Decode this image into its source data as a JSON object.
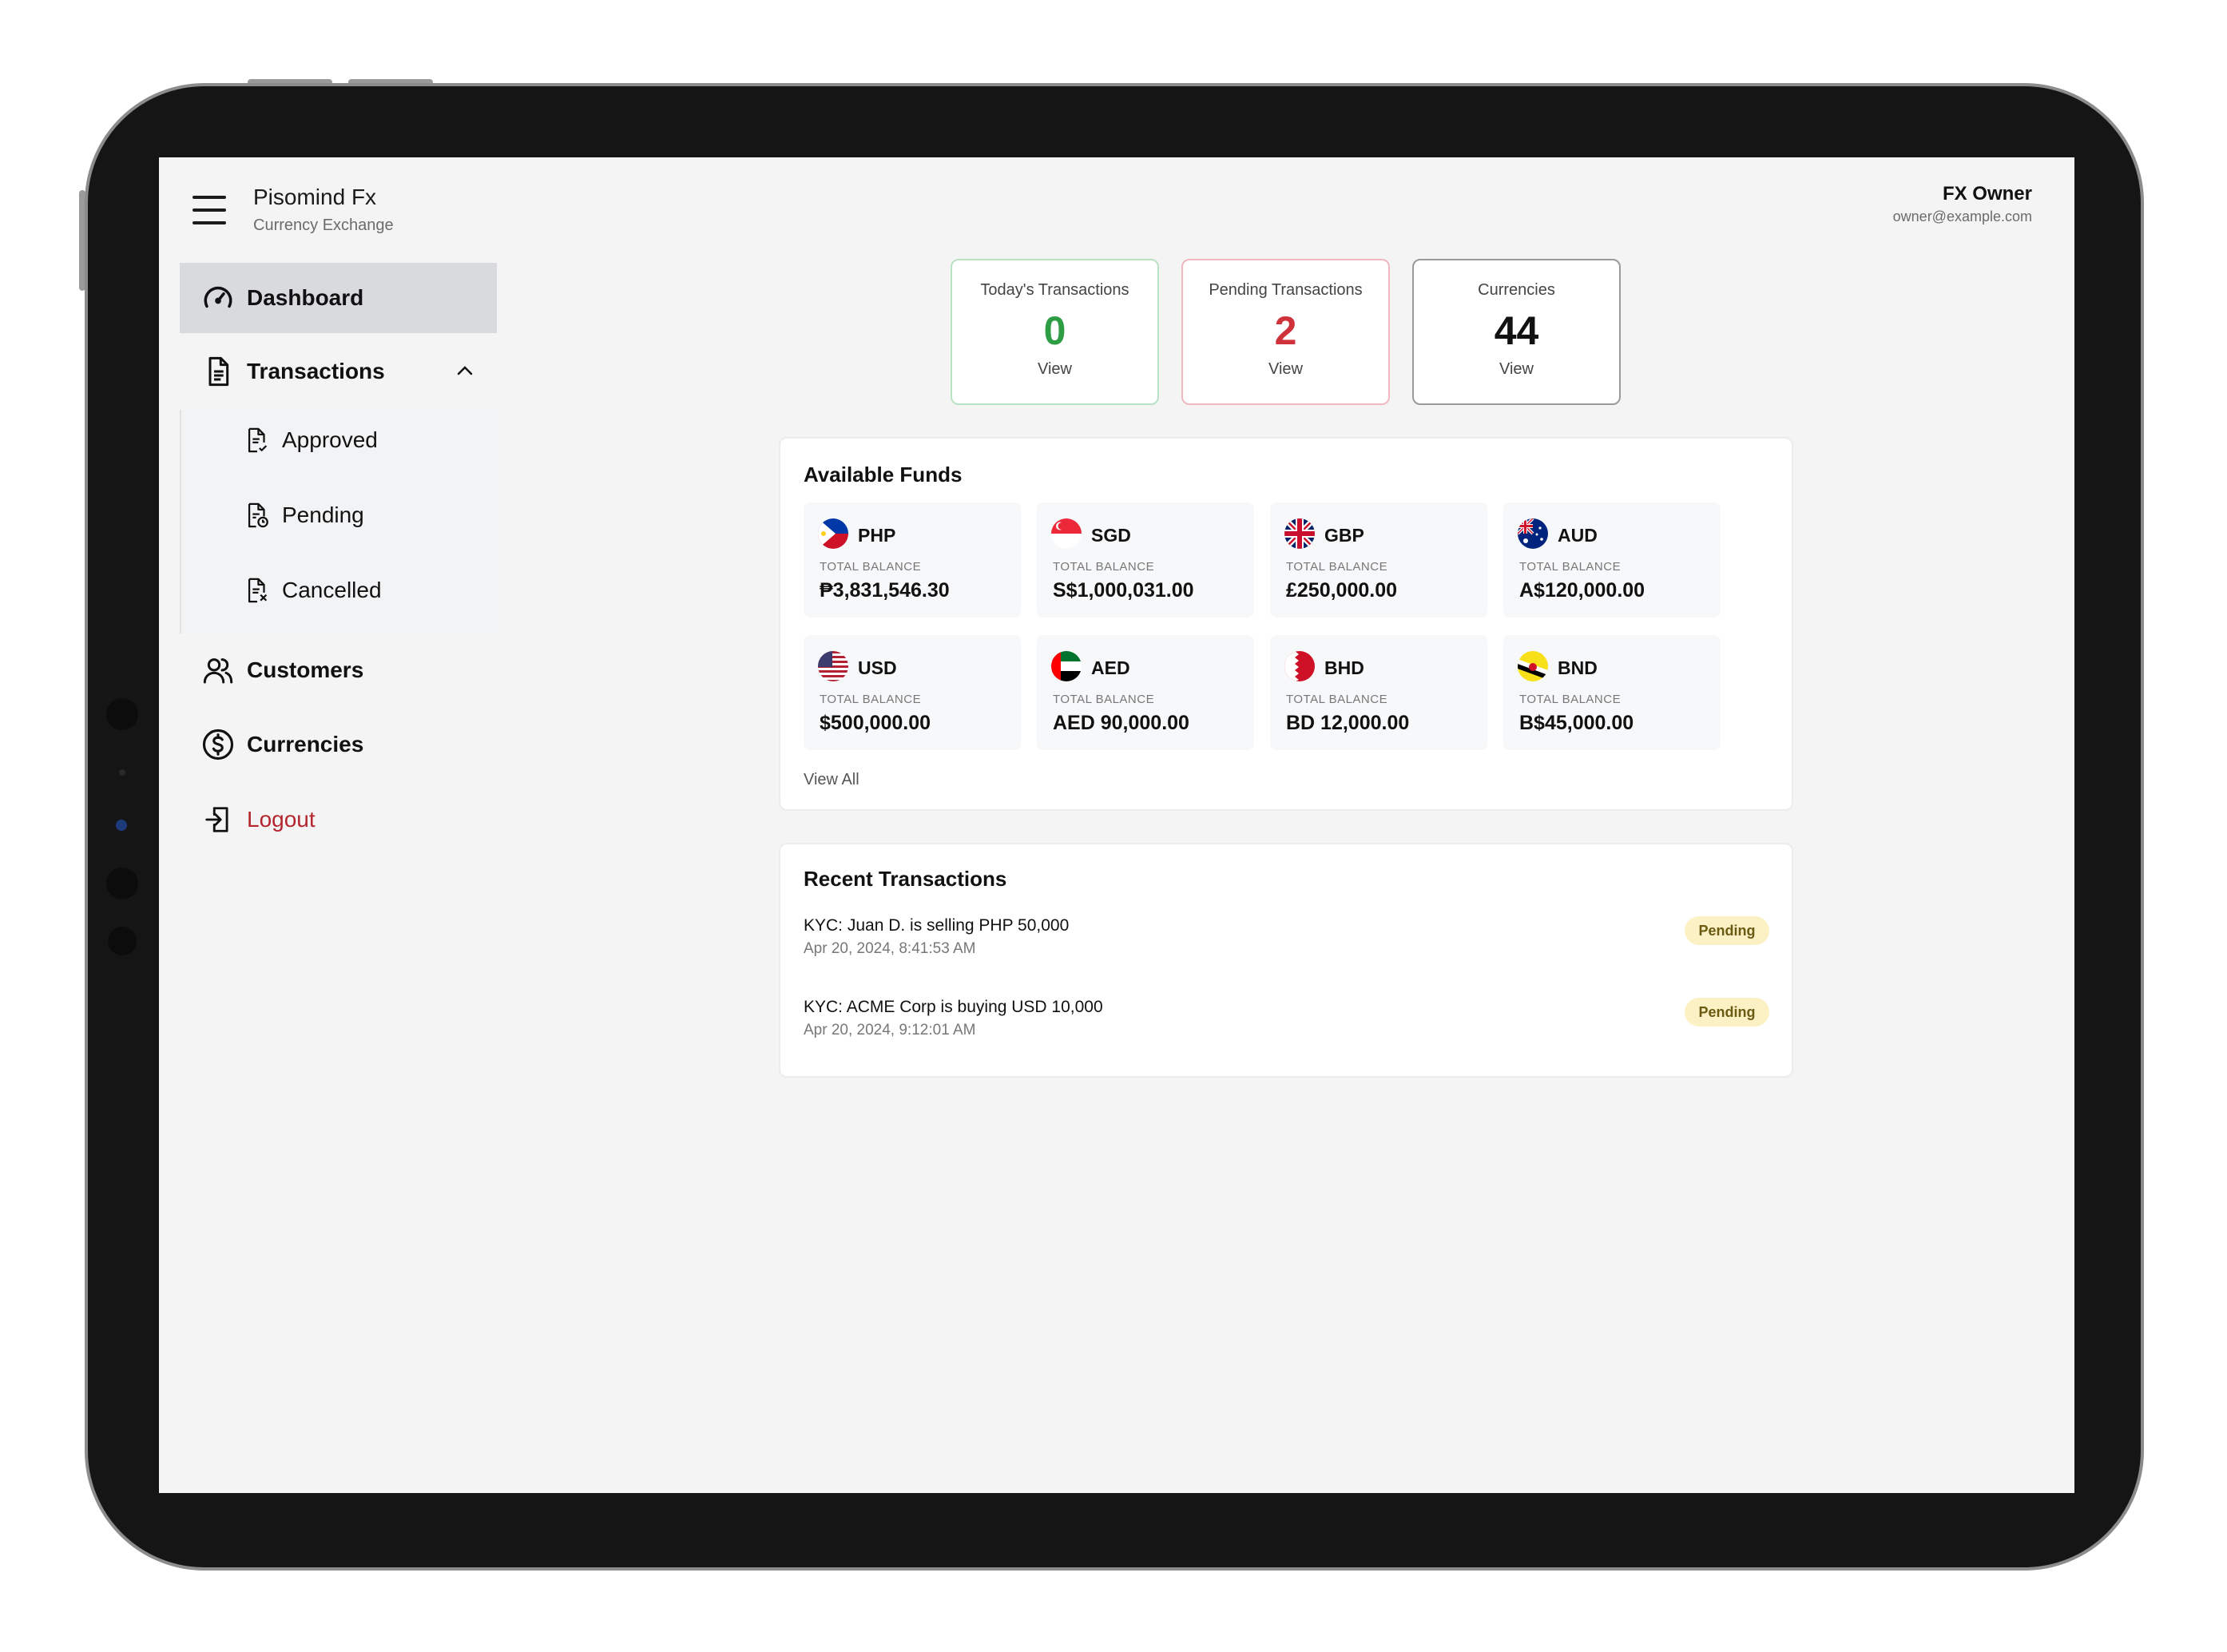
{
  "app": {
    "title": "Pisomind Fx",
    "subtitle": "Currency Exchange"
  },
  "user": {
    "name": "FX Owner",
    "email": "owner@example.com"
  },
  "sidebar": {
    "items": [
      {
        "label": "Dashboard",
        "icon": "gauge-icon",
        "active": true
      },
      {
        "label": "Transactions",
        "icon": "document-icon",
        "expanded": true
      },
      {
        "label": "Customers",
        "icon": "users-icon"
      },
      {
        "label": "Currencies",
        "icon": "dollar-circle-icon"
      },
      {
        "label": "Logout",
        "icon": "logout-icon"
      }
    ],
    "sub_items": [
      {
        "label": "Approved",
        "icon": "document-check-icon"
      },
      {
        "label": "Pending",
        "icon": "document-clock-icon"
      },
      {
        "label": "Cancelled",
        "icon": "document-x-icon"
      }
    ]
  },
  "stats": [
    {
      "title": "Today's Transactions",
      "value": "0",
      "link": "View",
      "color": "#2e9e45",
      "border": "#b8e2c2"
    },
    {
      "title": "Pending Transactions",
      "value": "2",
      "link": "View",
      "color": "#d0323b",
      "border": "#f0b8be"
    },
    {
      "title": "Currencies",
      "value": "44",
      "link": "View",
      "color": "#111111",
      "border": "#9a9a9a"
    }
  ],
  "funds": {
    "title": "Available Funds",
    "balance_label": "TOTAL BALANCE",
    "view_all": "View All",
    "items": [
      {
        "code": "PHP",
        "amount": "₱3,831,546.30",
        "flag": "ph-flag-icon"
      },
      {
        "code": "SGD",
        "amount": "S$1,000,031.00",
        "flag": "sg-flag-icon"
      },
      {
        "code": "GBP",
        "amount": "£250,000.00",
        "flag": "gb-flag-icon"
      },
      {
        "code": "AUD",
        "amount": "A$120,000.00",
        "flag": "au-flag-icon"
      },
      {
        "code": "USD",
        "amount": "$500,000.00",
        "flag": "us-flag-icon"
      },
      {
        "code": "AED",
        "amount": "AED 90,000.00",
        "flag": "ae-flag-icon"
      },
      {
        "code": "BHD",
        "amount": "BD 12,000.00",
        "flag": "bh-flag-icon"
      },
      {
        "code": "BND",
        "amount": "B$45,000.00",
        "flag": "bn-flag-icon"
      }
    ]
  },
  "recent": {
    "title": "Recent Transactions",
    "items": [
      {
        "text": "KYC: Juan D. is selling PHP 50,000",
        "date": "Apr 20, 2024, 8:41:53 AM",
        "status": "Pending"
      },
      {
        "text": "KYC: ACME Corp is buying USD 10,000",
        "date": "Apr 20, 2024, 9:12:01 AM",
        "status": "Pending"
      }
    ]
  }
}
